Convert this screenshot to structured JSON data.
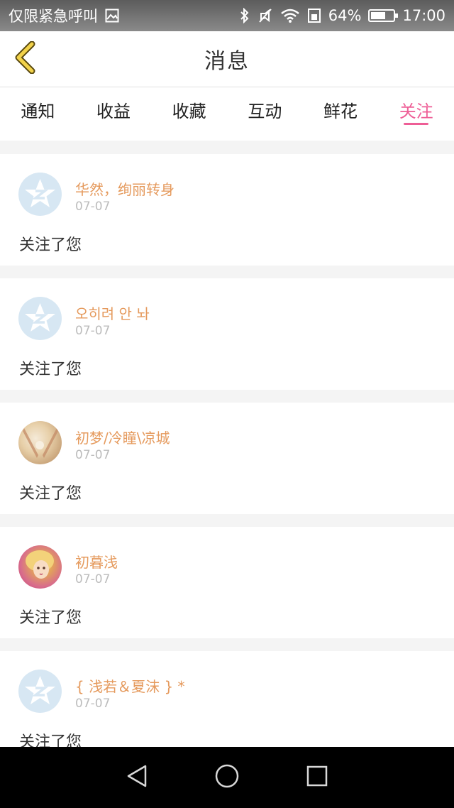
{
  "status_bar": {
    "carrier_text": "仅限紧急呼叫",
    "battery_text": "64%",
    "battery_level_percent": 64,
    "time": "17:00"
  },
  "header": {
    "title": "消息",
    "back_icon": "chevron-left-icon"
  },
  "tabs": [
    {
      "label": "通知",
      "active": false
    },
    {
      "label": "收益",
      "active": false
    },
    {
      "label": "收藏",
      "active": false
    },
    {
      "label": "互动",
      "active": false
    },
    {
      "label": "鲜花",
      "active": false
    },
    {
      "label": "关注",
      "active": true
    }
  ],
  "colors": {
    "accent": "#ee5e96",
    "username": "#e59a5d",
    "date": "#bcbcbc",
    "avatar_default": "#d7e7f3"
  },
  "notifications": [
    {
      "username": "华然，绚丽转身",
      "date": "07-07",
      "message": "关注了您",
      "avatar": "default"
    },
    {
      "username": "오히려 안 놔",
      "date": "07-07",
      "message": "关注了您",
      "avatar": "default"
    },
    {
      "username": "初梦/冷瞳\\凉城",
      "date": "07-07",
      "message": "关注了您",
      "avatar": "photo"
    },
    {
      "username": "初暮浅",
      "date": "07-07",
      "message": "关注了您",
      "avatar": "photo"
    },
    {
      "username": "{ 浅若＆夏沫 } *",
      "date": "07-07",
      "message": "关注了您",
      "avatar": "default"
    }
  ],
  "nav_bar": {
    "back_icon": "triangle-back-icon",
    "home_icon": "circle-home-icon",
    "recents_icon": "square-recents-icon"
  }
}
